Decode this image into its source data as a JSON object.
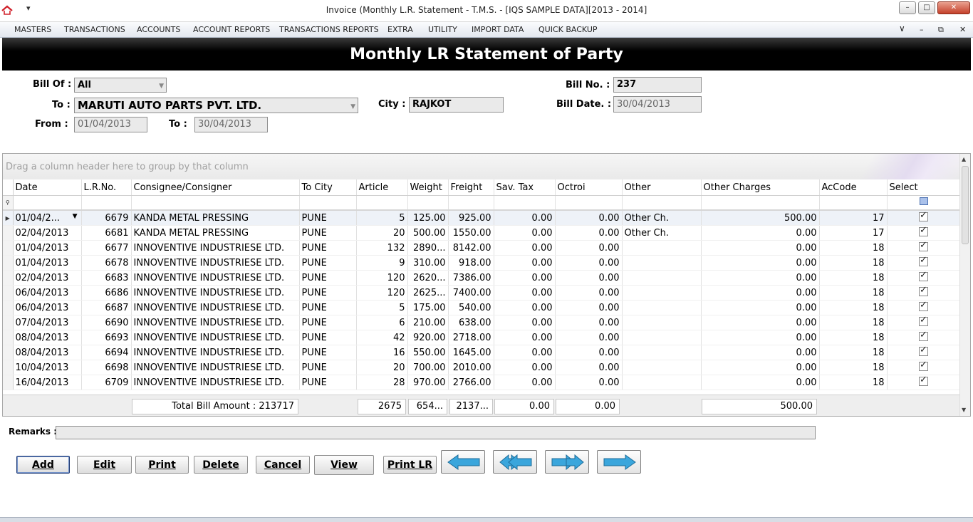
{
  "window": {
    "title": "Invoice (Monthly L.R. Statement - T.M.S. - [IQS SAMPLE DATA][2013 - 2014]",
    "min_glyph": "–",
    "max_glyph": "□",
    "close_glyph": "✕",
    "sys_menu_glyph": "▾"
  },
  "menu": {
    "items": [
      "MASTERS",
      "TRANSACTIONS",
      "ACCOUNTS",
      "ACCOUNT REPORTS",
      "TRANSACTIONS REPORTS",
      "EXTRA",
      "UTILITY",
      "IMPORT DATA",
      "QUICK BACKUP"
    ],
    "chevron_glyph": "∨",
    "min_glyph": "–",
    "restore_glyph": "⧉",
    "close_glyph": "✕"
  },
  "header": {
    "title": "Monthly LR Statement of Party"
  },
  "form": {
    "bill_of_label": "Bill Of :",
    "bill_of_value": "All",
    "to_label": "To :",
    "to_value": "MARUTI AUTO PARTS PVT. LTD.",
    "city_label": "City :",
    "city_value": "RAJKOT",
    "bill_no_label": "Bill No. :",
    "bill_no_value": "237",
    "bill_date_label": "Bill Date. :",
    "bill_date_value": "30/04/2013",
    "from_label": "From :",
    "from_value": "01/04/2013",
    "to_date_label": "To :",
    "to_date_value": "30/04/2013"
  },
  "grid": {
    "group_hint": "Drag a column header here to group by that column",
    "columns": [
      "Date",
      "L.R.No.",
      "Consignee/Consigner",
      "To City",
      "Article",
      "Weight",
      "Freight",
      "Sav. Tax",
      "Octroi",
      "Other",
      "Other Charges",
      "AcCode",
      "Select"
    ],
    "rows": [
      [
        "01/04/2...",
        "6679",
        "KANDA METAL PRESSING",
        "PUNE",
        "5",
        "125.00",
        "925.00",
        "0.00",
        "0.00",
        "Other Ch.",
        "500.00",
        "17"
      ],
      [
        "02/04/2013",
        "6681",
        "KANDA METAL PRESSING",
        "PUNE",
        "20",
        "500.00",
        "1550.00",
        "0.00",
        "0.00",
        "Other Ch.",
        "0.00",
        "17"
      ],
      [
        "01/04/2013",
        "6677",
        "INNOVENTIVE INDUSTRIESE LTD.",
        "PUNE",
        "132",
        "2890...",
        "8142.00",
        "0.00",
        "0.00",
        "",
        "0.00",
        "18"
      ],
      [
        "01/04/2013",
        "6678",
        "INNOVENTIVE INDUSTRIESE LTD.",
        "PUNE",
        "9",
        "310.00",
        "918.00",
        "0.00",
        "0.00",
        "",
        "0.00",
        "18"
      ],
      [
        "02/04/2013",
        "6683",
        "INNOVENTIVE INDUSTRIESE LTD.",
        "PUNE",
        "120",
        "2620...",
        "7386.00",
        "0.00",
        "0.00",
        "",
        "0.00",
        "18"
      ],
      [
        "06/04/2013",
        "6686",
        "INNOVENTIVE INDUSTRIESE LTD.",
        "PUNE",
        "120",
        "2625...",
        "7400.00",
        "0.00",
        "0.00",
        "",
        "0.00",
        "18"
      ],
      [
        "06/04/2013",
        "6687",
        "INNOVENTIVE INDUSTRIESE LTD.",
        "PUNE",
        "5",
        "175.00",
        "540.00",
        "0.00",
        "0.00",
        "",
        "0.00",
        "18"
      ],
      [
        "07/04/2013",
        "6690",
        "INNOVENTIVE INDUSTRIESE LTD.",
        "PUNE",
        "6",
        "210.00",
        "638.00",
        "0.00",
        "0.00",
        "",
        "0.00",
        "18"
      ],
      [
        "08/04/2013",
        "6693",
        "INNOVENTIVE INDUSTRIESE LTD.",
        "PUNE",
        "42",
        "920.00",
        "2718.00",
        "0.00",
        "0.00",
        "",
        "0.00",
        "18"
      ],
      [
        "08/04/2013",
        "6694",
        "INNOVENTIVE INDUSTRIESE LTD.",
        "PUNE",
        "16",
        "550.00",
        "1645.00",
        "0.00",
        "0.00",
        "",
        "0.00",
        "18"
      ],
      [
        "10/04/2013",
        "6698",
        "INNOVENTIVE INDUSTRIESE LTD.",
        "PUNE",
        "20",
        "700.00",
        "2010.00",
        "0.00",
        "0.00",
        "",
        "0.00",
        "18"
      ],
      [
        "16/04/2013",
        "6709",
        "INNOVENTIVE INDUSTRIESE LTD.",
        "PUNE",
        "28",
        "970.00",
        "2766.00",
        "0.00",
        "0.00",
        "",
        "0.00",
        "18"
      ]
    ],
    "totals": {
      "bill_amount": "Total Bill Amount : 213717",
      "article": "2675",
      "weight": "654...",
      "freight": "2137...",
      "sav_tax": "0.00",
      "octroi": "0.00",
      "other_charges": "500.00"
    }
  },
  "remarks": {
    "label": "Remarks :",
    "value": ""
  },
  "buttons": {
    "add": "Add",
    "edit": "Edit",
    "print": "Print",
    "delete": "Delete",
    "cancel": "Cancel",
    "view": "View",
    "print_lr": "Print LR"
  },
  "colors": {
    "banner": "#000000",
    "nav_arrow": "#3aa6dc",
    "selected_row": "#eef2f8"
  }
}
